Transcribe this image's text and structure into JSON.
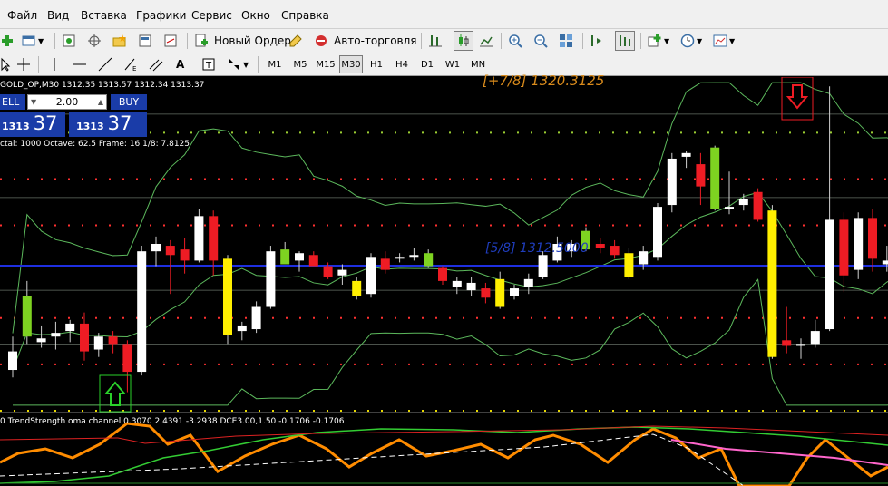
{
  "menu": {
    "items": [
      "Файл",
      "Вид",
      "Вставка",
      "Графики",
      "Сервис",
      "Окно",
      "Справка"
    ]
  },
  "toolbar": {
    "new_order": "Новый Ордер",
    "auto_trading": "Авто-торговля"
  },
  "timeframes": [
    "M1",
    "M5",
    "M15",
    "M30",
    "H1",
    "H4",
    "D1",
    "W1",
    "MN"
  ],
  "active_timeframe": "M30",
  "chart": {
    "header": "GOLD_OP,M30  1312.35 1313.57 1312.34 1313.37",
    "sell_label": "ELL",
    "buy_label": "BUY",
    "lot": "2.00",
    "sell_price_small": "1313",
    "sell_price_big": "37",
    "buy_price_small": "1313",
    "buy_price_big": "37",
    "info_line": "ctal: 1000   Octave: 62.5   Frame: 16   1/8: 7.8125",
    "label_top": "[+7/8]   1320.3125",
    "label_mid": "[5/8]   1312.5000",
    "indicator_header": "0 TrendStrength oma channel 0.3070 2.4391 -3.2938  DCE3.00,1.50 -0.1706 -0.1706"
  },
  "chart_data": {
    "type": "candlestick",
    "symbol": "GOLD_OP",
    "timeframe": "M30",
    "candles": [
      {
        "o": 11.2,
        "h": 12.0,
        "l": 9.8,
        "c": 10.2,
        "color": "white"
      },
      {
        "o": 12.0,
        "h": 15.0,
        "l": 11.6,
        "c": 14.2,
        "color": "lime"
      },
      {
        "o": 11.7,
        "h": 12.6,
        "l": 11.4,
        "c": 11.9,
        "color": "white"
      },
      {
        "o": 12.0,
        "h": 12.8,
        "l": 11.3,
        "c": 12.2,
        "color": "white"
      },
      {
        "o": 12.3,
        "h": 12.9,
        "l": 11.7,
        "c": 12.7,
        "color": "white"
      },
      {
        "o": 12.7,
        "h": 13.3,
        "l": 10.7,
        "c": 11.2,
        "color": "red"
      },
      {
        "o": 11.3,
        "h": 12.2,
        "l": 10.9,
        "c": 12.0,
        "color": "white"
      },
      {
        "o": 12.0,
        "h": 12.3,
        "l": 11.1,
        "c": 11.6,
        "color": "red"
      },
      {
        "o": 11.6,
        "h": 11.8,
        "l": 9.0,
        "c": 10.1,
        "color": "red"
      },
      {
        "o": 10.1,
        "h": 16.9,
        "l": 9.9,
        "c": 16.6,
        "color": "white"
      },
      {
        "o": 16.6,
        "h": 17.4,
        "l": 15.8,
        "c": 17.0,
        "color": "white"
      },
      {
        "o": 16.9,
        "h": 17.2,
        "l": 14.3,
        "c": 16.4,
        "color": "red"
      },
      {
        "o": 16.7,
        "h": 17.3,
        "l": 15.4,
        "c": 16.1,
        "color": "red"
      },
      {
        "o": 16.1,
        "h": 18.9,
        "l": 16.0,
        "c": 18.5,
        "color": "white"
      },
      {
        "o": 18.5,
        "h": 18.8,
        "l": 15.3,
        "c": 16.1,
        "color": "red"
      },
      {
        "o": 16.2,
        "h": 16.4,
        "l": 11.6,
        "c": 12.1,
        "color": "yellow"
      },
      {
        "o": 12.3,
        "h": 12.8,
        "l": 11.8,
        "c": 12.6,
        "color": "white"
      },
      {
        "o": 12.4,
        "h": 13.9,
        "l": 12.2,
        "c": 13.6,
        "color": "white"
      },
      {
        "o": 13.6,
        "h": 16.9,
        "l": 13.5,
        "c": 16.6,
        "color": "white"
      },
      {
        "o": 16.7,
        "h": 17.1,
        "l": 16.1,
        "c": 15.9,
        "color": "lime"
      },
      {
        "o": 16.1,
        "h": 16.6,
        "l": 15.5,
        "c": 16.5,
        "color": "white"
      },
      {
        "o": 16.4,
        "h": 16.6,
        "l": 15.8,
        "c": 15.8,
        "color": "red"
      },
      {
        "o": 15.8,
        "h": 16.0,
        "l": 15.1,
        "c": 15.2,
        "color": "red"
      },
      {
        "o": 15.3,
        "h": 15.9,
        "l": 14.8,
        "c": 15.6,
        "color": "white"
      },
      {
        "o": 15.0,
        "h": 15.2,
        "l": 14.0,
        "c": 14.2,
        "color": "yellow"
      },
      {
        "o": 14.3,
        "h": 16.5,
        "l": 14.1,
        "c": 16.3,
        "color": "white"
      },
      {
        "o": 16.2,
        "h": 16.6,
        "l": 15.4,
        "c": 15.6,
        "color": "red"
      },
      {
        "o": 16.3,
        "h": 16.5,
        "l": 16.0,
        "c": 16.3,
        "color": "white"
      },
      {
        "o": 16.4,
        "h": 16.8,
        "l": 16.1,
        "c": 16.4,
        "color": "white"
      },
      {
        "o": 16.5,
        "h": 16.7,
        "l": 15.7,
        "c": 15.8,
        "color": "lime"
      },
      {
        "o": 15.7,
        "h": 15.8,
        "l": 14.8,
        "c": 15.0,
        "color": "red"
      },
      {
        "o": 15.0,
        "h": 15.2,
        "l": 14.3,
        "c": 14.7,
        "color": "white"
      },
      {
        "o": 14.9,
        "h": 15.2,
        "l": 14.2,
        "c": 14.5,
        "color": "white"
      },
      {
        "o": 14.6,
        "h": 14.9,
        "l": 13.8,
        "c": 14.1,
        "color": "red"
      },
      {
        "o": 15.1,
        "h": 15.5,
        "l": 13.5,
        "c": 13.6,
        "color": "yellow"
      },
      {
        "o": 14.2,
        "h": 14.8,
        "l": 14.0,
        "c": 14.6,
        "color": "white"
      },
      {
        "o": 14.7,
        "h": 15.4,
        "l": 14.3,
        "c": 15.1,
        "color": "white"
      },
      {
        "o": 15.2,
        "h": 16.6,
        "l": 15.1,
        "c": 16.4,
        "color": "white"
      },
      {
        "o": 17.0,
        "h": 17.4,
        "l": 16.0,
        "c": 16.1,
        "color": "white"
      },
      {
        "o": 16.6,
        "h": 17.2,
        "l": 16.3,
        "c": 17.0,
        "color": "white"
      },
      {
        "o": 17.7,
        "h": 17.9,
        "l": 16.6,
        "c": 16.7,
        "color": "lime"
      },
      {
        "o": 17.0,
        "h": 17.3,
        "l": 16.5,
        "c": 16.8,
        "color": "red"
      },
      {
        "o": 16.9,
        "h": 17.2,
        "l": 16.2,
        "c": 16.4,
        "color": "red"
      },
      {
        "o": 16.5,
        "h": 16.8,
        "l": 15.1,
        "c": 15.2,
        "color": "yellow"
      },
      {
        "o": 15.9,
        "h": 16.9,
        "l": 15.6,
        "c": 16.6,
        "color": "white"
      },
      {
        "o": 16.3,
        "h": 19.2,
        "l": 16.1,
        "c": 19.0,
        "color": "white"
      },
      {
        "o": 19.1,
        "h": 21.9,
        "l": 18.7,
        "c": 21.6,
        "color": "white"
      },
      {
        "o": 21.7,
        "h": 22.0,
        "l": 21.1,
        "c": 21.9,
        "color": "white"
      },
      {
        "o": 21.3,
        "h": 21.9,
        "l": 19.1,
        "c": 20.1,
        "color": "red"
      },
      {
        "o": 22.2,
        "h": 22.3,
        "l": 18.8,
        "c": 18.9,
        "color": "lime"
      },
      {
        "o": 18.9,
        "h": 20.9,
        "l": 18.6,
        "c": 19.0,
        "color": "white"
      },
      {
        "o": 19.1,
        "h": 19.7,
        "l": 18.8,
        "c": 19.4,
        "color": "white"
      },
      {
        "o": 19.8,
        "h": 20.0,
        "l": 18.2,
        "c": 18.3,
        "color": "red"
      },
      {
        "o": 18.8,
        "h": 19.1,
        "l": 10.8,
        "c": 10.9,
        "color": "yellow"
      },
      {
        "o": 11.8,
        "h": 13.6,
        "l": 11.1,
        "c": 11.5,
        "color": "red"
      },
      {
        "o": 11.5,
        "h": 11.9,
        "l": 10.8,
        "c": 11.6,
        "color": "white"
      },
      {
        "o": 11.6,
        "h": 12.9,
        "l": 11.4,
        "c": 12.3,
        "color": "white"
      },
      {
        "o": 12.4,
        "h": 25.5,
        "l": 12.3,
        "c": 18.3,
        "color": "white"
      },
      {
        "o": 18.3,
        "h": 18.7,
        "l": 14.4,
        "c": 15.3,
        "color": "red"
      },
      {
        "o": 15.6,
        "h": 18.7,
        "l": 15.1,
        "c": 18.4,
        "color": "white"
      },
      {
        "o": 18.4,
        "h": 18.9,
        "l": 15.5,
        "c": 16.2,
        "color": "red"
      },
      {
        "o": 16.1,
        "h": 16.9,
        "l": 15.5,
        "c": 15.9,
        "color": "white"
      },
      {
        "o": 15.9,
        "h": 16.1,
        "l": 14.9,
        "c": 15.2,
        "color": "red"
      },
      {
        "o": 15.2,
        "h": 15.5,
        "l": 14.7,
        "c": 14.8,
        "color": "white"
      }
    ],
    "levels": {
      "blue_line": 15.8,
      "dotted_lime": [
        23.0
      ],
      "dotted_red": [
        20.5,
        18.0,
        13.0,
        10.5
      ],
      "dotted_yellow": [
        8.0
      ]
    },
    "labels": [
      "[+7/8]   1320.3125",
      "[5/8]   1312.5000"
    ]
  }
}
